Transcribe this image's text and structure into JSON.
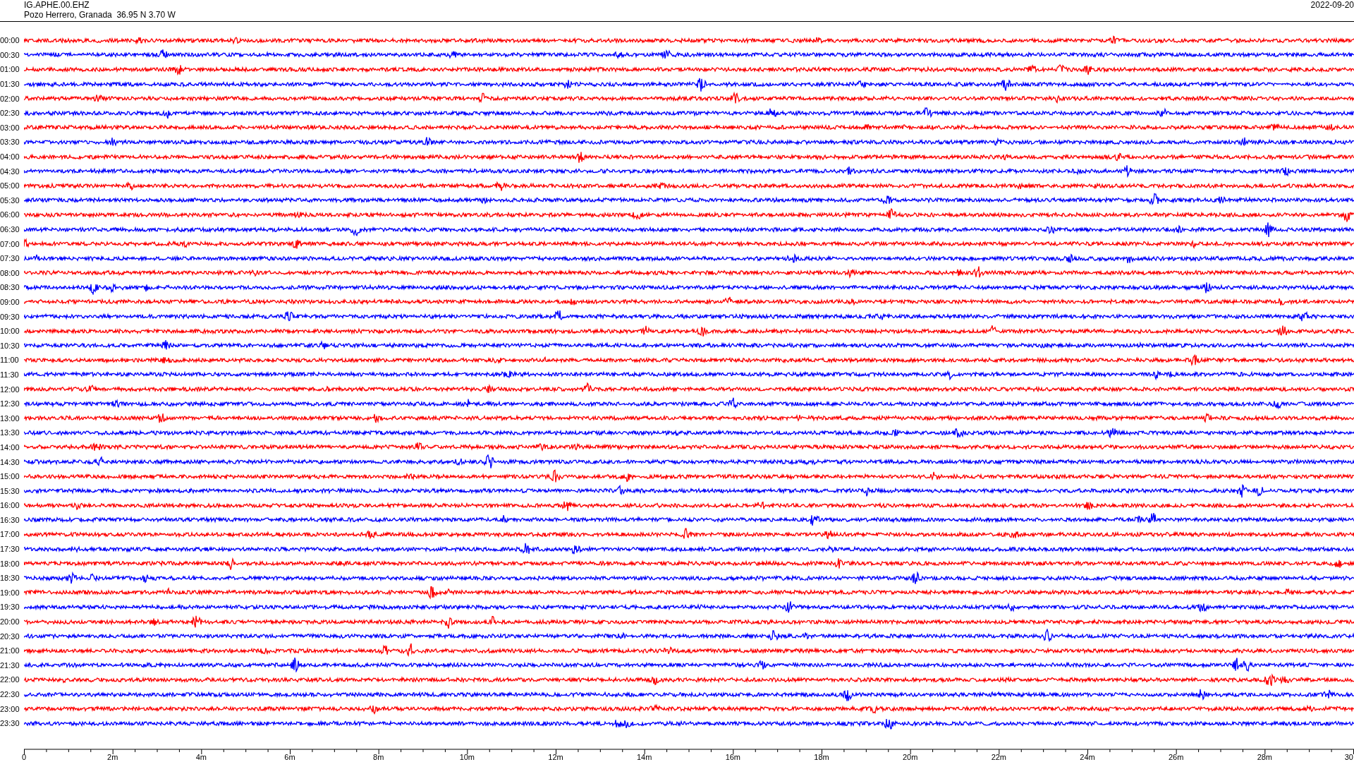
{
  "header": {
    "station": "IG.APHE.00.EHZ",
    "location": "Pozo Herrero, Granada  36.95 N 3.70 W",
    "date": "2022-09-20"
  },
  "traces": [
    {
      "label": "00:00",
      "color": "#ff0000"
    },
    {
      "label": "00:30",
      "color": "#0000ff"
    },
    {
      "label": "01:00",
      "color": "#ff0000"
    },
    {
      "label": "01:30",
      "color": "#0000ff"
    },
    {
      "label": "02:00",
      "color": "#ff0000"
    },
    {
      "label": "02:30",
      "color": "#0000ff"
    },
    {
      "label": "03:00",
      "color": "#ff0000"
    },
    {
      "label": "03:30",
      "color": "#0000ff"
    },
    {
      "label": "04:00",
      "color": "#ff0000"
    },
    {
      "label": "04:30",
      "color": "#0000ff"
    },
    {
      "label": "05:00",
      "color": "#ff0000"
    },
    {
      "label": "05:30",
      "color": "#0000ff"
    },
    {
      "label": "06:00",
      "color": "#ff0000"
    },
    {
      "label": "06:30",
      "color": "#0000ff"
    },
    {
      "label": "07:00",
      "color": "#ff0000"
    },
    {
      "label": "07:30",
      "color": "#0000ff"
    },
    {
      "label": "08:00",
      "color": "#ff0000"
    },
    {
      "label": "08:30",
      "color": "#0000ff"
    },
    {
      "label": "09:00",
      "color": "#ff0000"
    },
    {
      "label": "09:30",
      "color": "#0000ff"
    },
    {
      "label": "10:00",
      "color": "#ff0000"
    },
    {
      "label": "10:30",
      "color": "#0000ff"
    },
    {
      "label": "11:00",
      "color": "#ff0000"
    },
    {
      "label": "11:30",
      "color": "#0000ff"
    },
    {
      "label": "12:00",
      "color": "#ff0000"
    },
    {
      "label": "12:30",
      "color": "#0000ff"
    },
    {
      "label": "13:00",
      "color": "#ff0000"
    },
    {
      "label": "13:30",
      "color": "#0000ff"
    },
    {
      "label": "14:00",
      "color": "#ff0000"
    },
    {
      "label": "14:30",
      "color": "#0000ff"
    },
    {
      "label": "15:00",
      "color": "#ff0000"
    },
    {
      "label": "15:30",
      "color": "#0000ff"
    },
    {
      "label": "16:00",
      "color": "#ff0000"
    },
    {
      "label": "16:30",
      "color": "#0000ff"
    },
    {
      "label": "17:00",
      "color": "#ff0000"
    },
    {
      "label": "17:30",
      "color": "#0000ff"
    },
    {
      "label": "18:00",
      "color": "#ff0000"
    },
    {
      "label": "18:30",
      "color": "#0000ff"
    },
    {
      "label": "19:00",
      "color": "#ff0000"
    },
    {
      "label": "19:30",
      "color": "#0000ff"
    },
    {
      "label": "20:00",
      "color": "#ff0000"
    },
    {
      "label": "20:30",
      "color": "#0000ff"
    },
    {
      "label": "21:00",
      "color": "#ff0000"
    },
    {
      "label": "21:30",
      "color": "#0000ff"
    },
    {
      "label": "22:00",
      "color": "#ff0000"
    },
    {
      "label": "22:30",
      "color": "#0000ff"
    },
    {
      "label": "23:00",
      "color": "#ff0000"
    },
    {
      "label": "23:30",
      "color": "#0000ff"
    }
  ],
  "x_axis": {
    "tick_labels": [
      "0",
      "2m",
      "4m",
      "6m",
      "8m",
      "10m",
      "12m",
      "14m",
      "16m",
      "18m",
      "20m",
      "22m",
      "24m",
      "26m",
      "28m",
      "30"
    ]
  }
}
